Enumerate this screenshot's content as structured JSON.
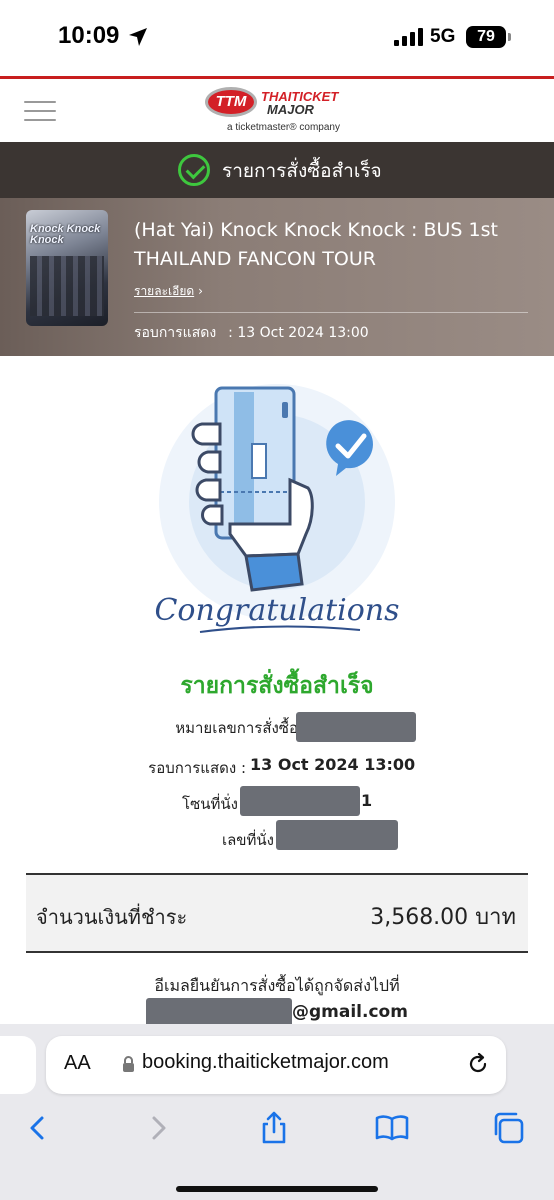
{
  "status_bar": {
    "time": "10:09",
    "network": "5G",
    "battery": "79"
  },
  "header": {
    "logo_badge": "TTM",
    "logo_line1": "THAITICKET",
    "logo_line2": "MAJOR",
    "logo_sub": "a ticketmaster® company"
  },
  "banner": {
    "text": "รายการสั่งซื้อสำเร็จ"
  },
  "event": {
    "poster_text": "Knock Knock Knock",
    "title": "(Hat Yai) Knock Knock Knock : BUS 1st THAILAND FANCON TOUR",
    "detail_link": "รายละเอียด",
    "show_label": "รอบการแสดง",
    "show_value": ": 13 Oct 2024 13:00"
  },
  "illustration": {
    "caption": "Congratulations"
  },
  "order": {
    "title": "รายการสั่งซื้อสำเร็จ",
    "order_no_label": "หมายเลขการสั่งซื้อ",
    "show_label": "รอบการแสดง :",
    "show_value": "13 Oct 2024 13:00",
    "zone_label": "โซนที่นั่ง",
    "zone_suffix": "1",
    "seat_label": "เลขที่นั่ง"
  },
  "payment": {
    "amount_label": "จำนวนเงินที่ชำระ",
    "amount_value": "3,568.00 บาท"
  },
  "email": {
    "note": "อีเมลยืนยันการสั่งซื้อได้ถูกจัดส่งไปที่",
    "suffix": "@gmail.com"
  },
  "browser": {
    "aa": "AA",
    "url": "booking.thaiticketmajor.com"
  },
  "colors": {
    "brand_red": "#d32027",
    "success_green": "#2ea82e",
    "banner_bg": "#3b3532",
    "illustration_blue": "#4a90d9"
  }
}
